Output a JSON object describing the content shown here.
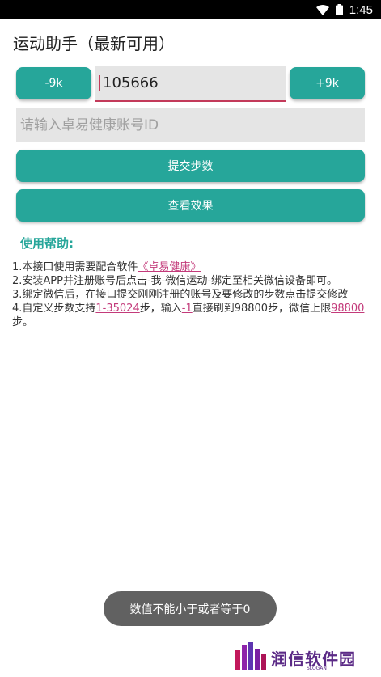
{
  "status_bar": {
    "time": "1:45"
  },
  "app": {
    "title": "运动助手（最新可用）"
  },
  "controls": {
    "minus_label": "-9k",
    "plus_label": "+9k",
    "steps_value": "105666",
    "account_placeholder": "请输入卓易健康账号ID",
    "submit_label": "提交步数",
    "check_label": "查看效果"
  },
  "help": {
    "heading": "使用帮助:",
    "line1_text": "1.本接口使用需要配合软件",
    "line1_link": "《卓易健康》",
    "line2": "2.安装APP并注册账号后点击-我-微信运动-绑定至相关微信设备即可。",
    "line3": "3.绑定微信后，在接口提交刚刚注册的账号及要修改的步数点击提交修改",
    "line4_a": "4.自定义步数支持",
    "line4_range": "1-35024",
    "line4_b": "步，输入",
    "line4_input": "-1",
    "line4_c": "直接刷到98800步，微信上限",
    "line4_limit": "98800",
    "line4_d": "步。"
  },
  "toast": {
    "message": "数值不能小于或者等于0"
  },
  "watermark": {
    "text": "润信软件园",
    "sub": "SLOGAN"
  },
  "colors": {
    "accent": "#26a69a",
    "link": "#c33a7a",
    "toast_bg": "#616161"
  }
}
